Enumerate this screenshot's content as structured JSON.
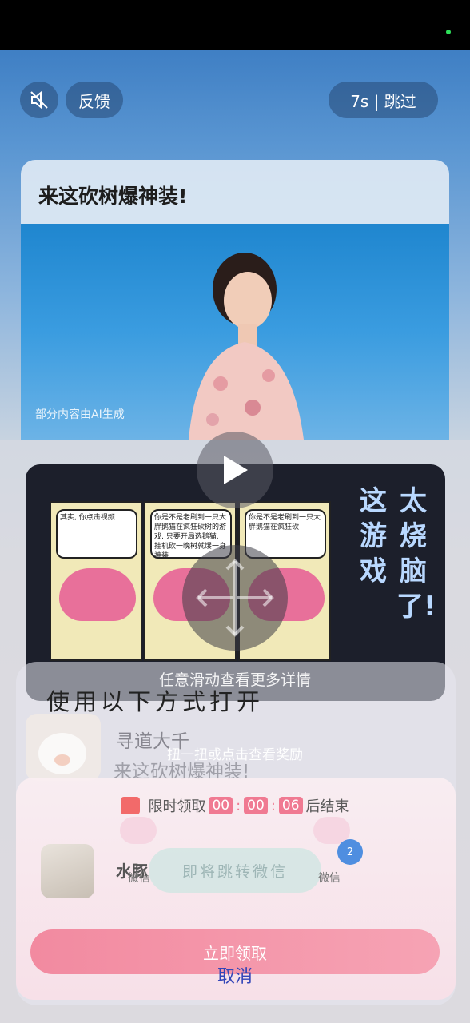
{
  "ad_top": {
    "feedback_label": "反馈",
    "skip_label": "7s | 跳过"
  },
  "hero": {
    "headline": "来这砍树爆神装!",
    "ai_notice": "部分内容由AI生成"
  },
  "game_card": {
    "panels": [
      "其实,\n你点击视频",
      "你是不是老刷到一只大胖鹅猫在疯狂砍树的游戏, 只要开局选鹅猫, 挂机砍一晚树就爆一身神装",
      "你是不是老刷到一只大胖鹅猫在疯狂砍"
    ],
    "title_col1": "这游戏",
    "title_col2": "太烧脑了!"
  },
  "swipe_hint": "任意滑动查看更多详情",
  "open_with": {
    "title": "使用以下方式打开",
    "app_name": "寻道大千",
    "app_desc": "来这砍树爆神装!"
  },
  "twist_hint": "扭一扭或点击查看奖励",
  "reward": {
    "prefix": "限时领取",
    "hh": "00",
    "mm": "00",
    "ss": "06",
    "suffix": "后结束",
    "app_name": "水豚",
    "app_sub": "微信",
    "app_right": "微信",
    "badge": "2",
    "jump_label": "即将跳转微信",
    "claim_label": "立即领取",
    "cancel_label": "取消"
  }
}
